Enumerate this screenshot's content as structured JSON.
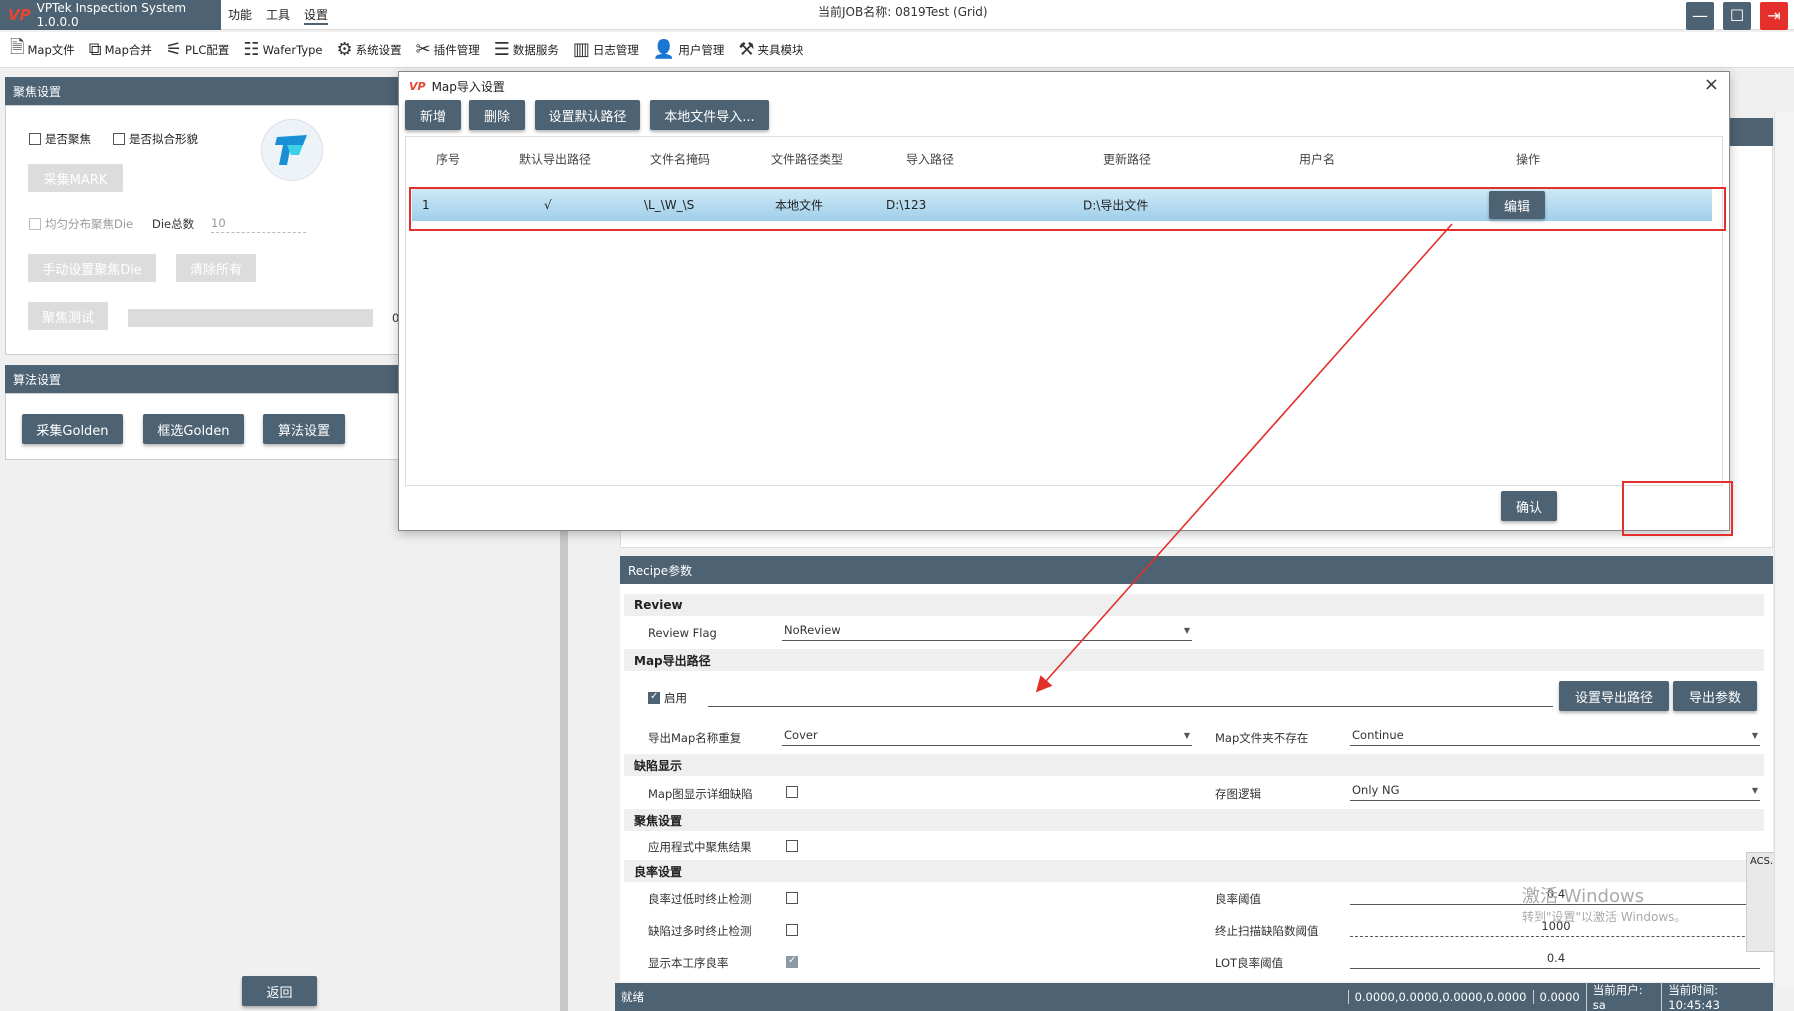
{
  "app": {
    "title": "VPTek Inspection System 1.0.0.0",
    "logo": "VP",
    "job": "当前JOB名称:  0819Test (Grid)"
  },
  "menu": [
    "功能",
    "工具",
    "设置"
  ],
  "toolbar": [
    {
      "label": "Map文件",
      "icon": "file-icon"
    },
    {
      "label": "Map合并",
      "icon": "merge-icon"
    },
    {
      "label": "PLC配置",
      "icon": "plc-icon"
    },
    {
      "label": "WaferType",
      "icon": "grid-icon"
    },
    {
      "label": "系统设置",
      "icon": "gear-icon"
    },
    {
      "label": "插件管理",
      "icon": "tools-icon"
    },
    {
      "label": "数据服务",
      "icon": "server-icon"
    },
    {
      "label": "日志管理",
      "icon": "log-icon"
    },
    {
      "label": "用户管理",
      "icon": "user-icon"
    },
    {
      "label": "夹具模块",
      "icon": "fixture-icon"
    }
  ],
  "focus_panel": {
    "title": "聚焦设置",
    "chk_focus": "是否聚焦",
    "chk_fit": "是否拟合形貌",
    "btn_mark": "采集MARK",
    "chk_uniform": "均匀分布聚焦Die",
    "die_total_label": "Die总数",
    "die_total_value": "10",
    "btn_manual": "手动设置聚焦Die",
    "btn_clear": "清除所有",
    "btn_test": "聚焦测试",
    "zero": "0"
  },
  "algo_panel": {
    "title": "算法设置",
    "btn_golden": "采集Golden",
    "btn_select": "框选Golden",
    "btn_algo": "算法设置"
  },
  "back_button": "返回",
  "dialog": {
    "logo": "VP",
    "title": "Map导入设置",
    "buttons": [
      "新增",
      "删除",
      "设置默认路径",
      "本地文件导入..."
    ],
    "columns": [
      "序号",
      "默认导出路径",
      "文件名掩码",
      "文件路径类型",
      "导入路径",
      "更新路径",
      "用户名",
      "操作"
    ],
    "row": {
      "index": "1",
      "default": "√",
      "mask": "\\L_\\W_\\S",
      "type": "本地文件",
      "import": "D:\\123",
      "update": "D:\\导出文件",
      "user": "",
      "action": "编辑"
    },
    "confirm": "确认"
  },
  "recipe": {
    "title": "Recipe参数",
    "review": {
      "section": "Review",
      "flag_label": "Review Flag",
      "flag_value": "NoReview"
    },
    "map_export": {
      "section": "Map导出路径",
      "enable_label": "启用",
      "btn_set": "设置导出路径",
      "btn_export": "导出参数",
      "dup_label": "导出Map名称重复",
      "dup_value": "Cover",
      "notexist_label": "Map文件夹不存在",
      "notexist_value": "Continue"
    },
    "defect": {
      "section": "缺陷显示",
      "detail_label": "Map图显示详细缺陷",
      "save_label": "存图逻辑",
      "save_value": "Only NG"
    },
    "focus": {
      "section": "聚焦设置",
      "apply_label": "应用程式中聚焦结果"
    },
    "yield": {
      "section": "良率设置",
      "low_label": "良率过低时终止检测",
      "threshold_label": "良率阈值",
      "threshold_value": "0.4",
      "many_label": "缺陷过多时终止检测",
      "stop_label": "终止扫描缺陷数阈值",
      "stop_value": "1000",
      "show_label": "显示本工序良率",
      "lot_label": "LOT良率阈值",
      "lot_value": "0.4"
    }
  },
  "side_tag": "ACS.ESto",
  "watermark": {
    "line1": "激活 Windows",
    "line2": "转到\"设置\"以激活 Windows。"
  },
  "status": {
    "ready": "就绪",
    "coords": "0.0000,0.0000,0.0000,0.0000",
    "val": "0.0000",
    "user": "当前用户:  sa",
    "time": "当前时间:  10:45:43"
  }
}
